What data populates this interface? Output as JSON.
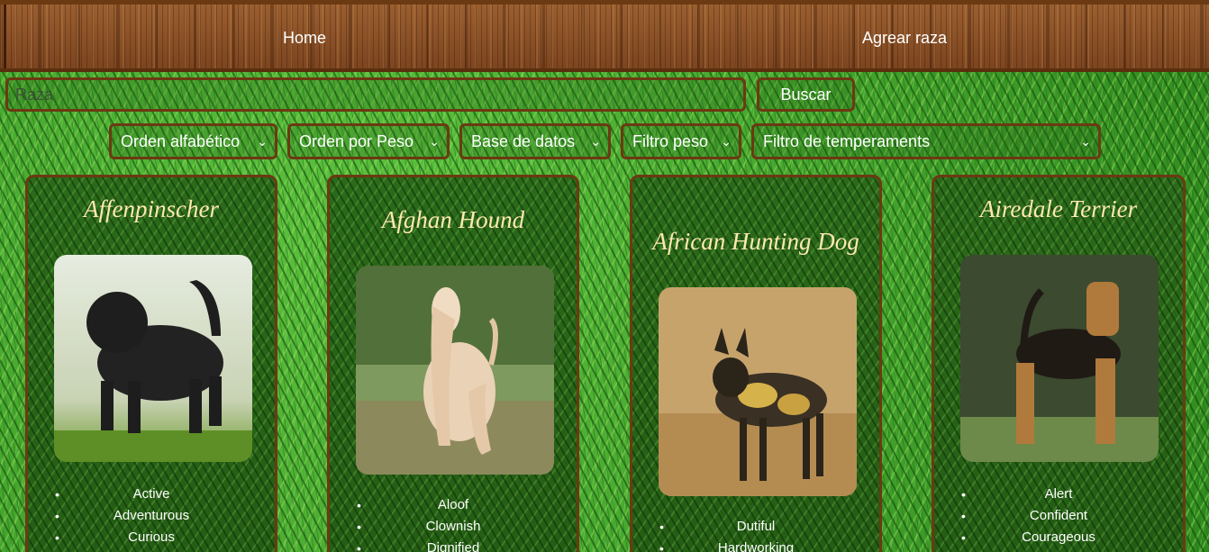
{
  "nav": {
    "home_label": "Home",
    "add_label": "Agrear raza"
  },
  "search": {
    "placeholder": "Raza",
    "button_label": "Buscar"
  },
  "filters": {
    "alpha": "Orden alfabético",
    "weight_order": "Orden por Peso",
    "database": "Base de datos",
    "weight_filter": "Filtro peso",
    "temperaments": "Filtro de temperaments"
  },
  "icons": {
    "select_chevron": "chevron-down-icon"
  },
  "cards": [
    {
      "name": "Affenpinscher",
      "temperaments": [
        "Active",
        "Adventurous",
        "Curious"
      ]
    },
    {
      "name": "Afghan Hound",
      "temperaments": [
        "Aloof",
        "Clownish",
        "Dignified"
      ]
    },
    {
      "name": "African Hunting Dog",
      "temperaments": [
        "Dutiful",
        "Hardworking"
      ]
    },
    {
      "name": "Airedale Terrier",
      "temperaments": [
        "Alert",
        "Confident",
        "Courageous"
      ]
    }
  ],
  "colors": {
    "border_brown": "#6b3a12",
    "title_cream": "#ffe9b0",
    "grass_green": "#3f9a2a"
  }
}
